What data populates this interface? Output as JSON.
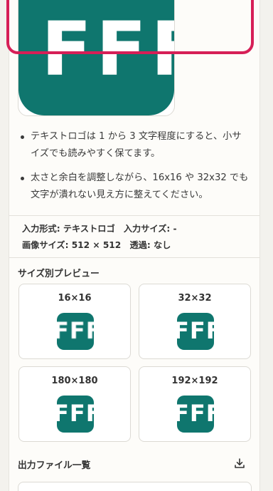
{
  "preview": {
    "letters": "FFF"
  },
  "tips": [
    "テキストロゴは 1 から 3 文字程度にすると、小サイズでも読みやすく保てます。",
    "太さと余白を調整しながら、16x16 や 32x32 でも文字が潰れない見え方に整えてください。"
  ],
  "meta": {
    "line1": "入力形式: テキストロゴ　入力サイズ: -",
    "line2": "画像サイズ: 512 × 512　透過: なし"
  },
  "size_preview": {
    "title": "サイズ別プレビュー",
    "items": [
      {
        "label": "16×16",
        "letters": "FFF"
      },
      {
        "label": "32×32",
        "letters": "FFF"
      },
      {
        "label": "180×180",
        "letters": "FFF"
      },
      {
        "label": "192×192",
        "letters": "FFF"
      }
    ]
  },
  "output_files": {
    "title": "出力ファイル一覧",
    "icon": "download-icon"
  },
  "colors": {
    "icon_bg": "#0f766e",
    "highlight": "#d61f57",
    "panel_bg": "#fdfcf9"
  }
}
